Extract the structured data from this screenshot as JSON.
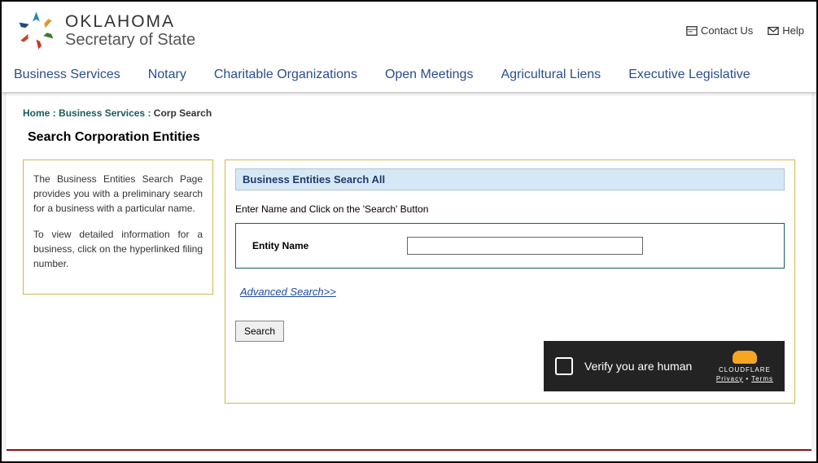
{
  "header": {
    "logo_line1": "OKLAHOMA",
    "logo_line2": "Secretary of State",
    "contact_label": "Contact Us",
    "help_label": "Help"
  },
  "nav": {
    "items": [
      "Business Services",
      "Notary",
      "Charitable Organizations",
      "Open Meetings",
      "Agricultural Liens",
      "Executive Legislative"
    ]
  },
  "breadcrumb": {
    "home": "Home",
    "section": "Business Services",
    "current": "Corp Search"
  },
  "page_title": "Search Corporation Entities",
  "sidebar": {
    "para1": "The Business Entities Search Page provides you with a preliminary search for a business with a particular name.",
    "para2": "To view detailed information for a business, click on the hyperlinked filing number."
  },
  "main": {
    "panel_header": "Business Entities Search All",
    "instruction": "Enter Name and Click on the 'Search' Button",
    "entity_name_label": "Entity Name",
    "entity_name_value": "",
    "advanced_search": "Advanced Search>>",
    "search_button": "Search"
  },
  "captcha": {
    "text": "Verify you are human",
    "brand": "CLOUDFLARE",
    "privacy": "Privacy",
    "terms": "Terms"
  }
}
